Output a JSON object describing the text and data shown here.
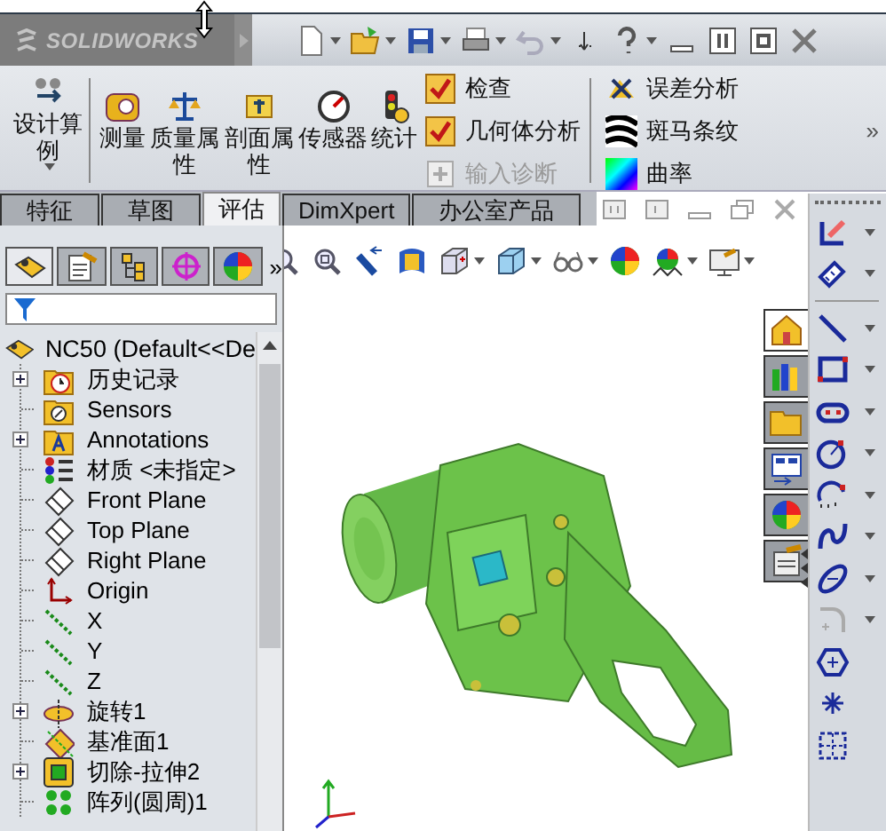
{
  "title_bar": {
    "logo": "SOLIDWORKS"
  },
  "ribbon": {
    "large_buttons": [
      {
        "label": "设计算例",
        "kind": "study"
      },
      {
        "label": "测量",
        "kind": "measure"
      },
      {
        "label": "质量属性",
        "kind": "mass"
      },
      {
        "label": "剖面属性",
        "kind": "section"
      },
      {
        "label": "传感器",
        "kind": "sensor"
      },
      {
        "label": "统计",
        "kind": "statistics"
      }
    ],
    "checks": [
      {
        "label": "检查",
        "disabled": false
      },
      {
        "label": "几何体分析",
        "disabled": false
      },
      {
        "label": "输入诊断",
        "disabled": true
      }
    ],
    "analysis": [
      {
        "label": "误差分析",
        "kind": "deviation"
      },
      {
        "label": "斑马条纹",
        "kind": "zebra"
      },
      {
        "label": "曲率",
        "kind": "curvature"
      }
    ],
    "more": "»"
  },
  "tabs": [
    {
      "label": "特征",
      "selected": false
    },
    {
      "label": "草图",
      "selected": false
    },
    {
      "label": "评估",
      "selected": true
    },
    {
      "label": "DimXpert",
      "selected": false
    },
    {
      "label": "办公室产品",
      "selected": false
    }
  ],
  "task_pane_tabs": [
    {
      "selected": true
    },
    {
      "selected": false
    },
    {
      "selected": false
    },
    {
      "selected": false
    },
    {
      "selected": false
    },
    {
      "selected": false
    }
  ],
  "panel_tabs": [
    {
      "selected": true
    },
    {
      "selected": false
    },
    {
      "selected": false
    },
    {
      "selected": false
    },
    {
      "selected": false
    }
  ],
  "panel": {
    "more": "»",
    "root": "NC50  (Default<<De",
    "tree": [
      {
        "label": "历史记录",
        "kind": "history",
        "expanded": false
      },
      {
        "label": "Sensors",
        "kind": "sensors"
      },
      {
        "label": "Annotations",
        "kind": "annotations",
        "expanded": false
      },
      {
        "label": "材质 <未指定>",
        "kind": "material"
      },
      {
        "label": "Front Plane",
        "kind": "plane"
      },
      {
        "label": "Top Plane",
        "kind": "plane"
      },
      {
        "label": "Right Plane",
        "kind": "plane"
      },
      {
        "label": "Origin",
        "kind": "origin"
      },
      {
        "label": "X",
        "kind": "axis"
      },
      {
        "label": "Y",
        "kind": "axis"
      },
      {
        "label": "Z",
        "kind": "axis"
      },
      {
        "label": "旋转1",
        "kind": "revolve",
        "expanded": false
      },
      {
        "label": "基准面1",
        "kind": "refplane"
      },
      {
        "label": "切除-拉伸2",
        "kind": "cut",
        "expanded": false
      },
      {
        "label": "阵列(圆周)1",
        "kind": "pattern"
      }
    ]
  }
}
